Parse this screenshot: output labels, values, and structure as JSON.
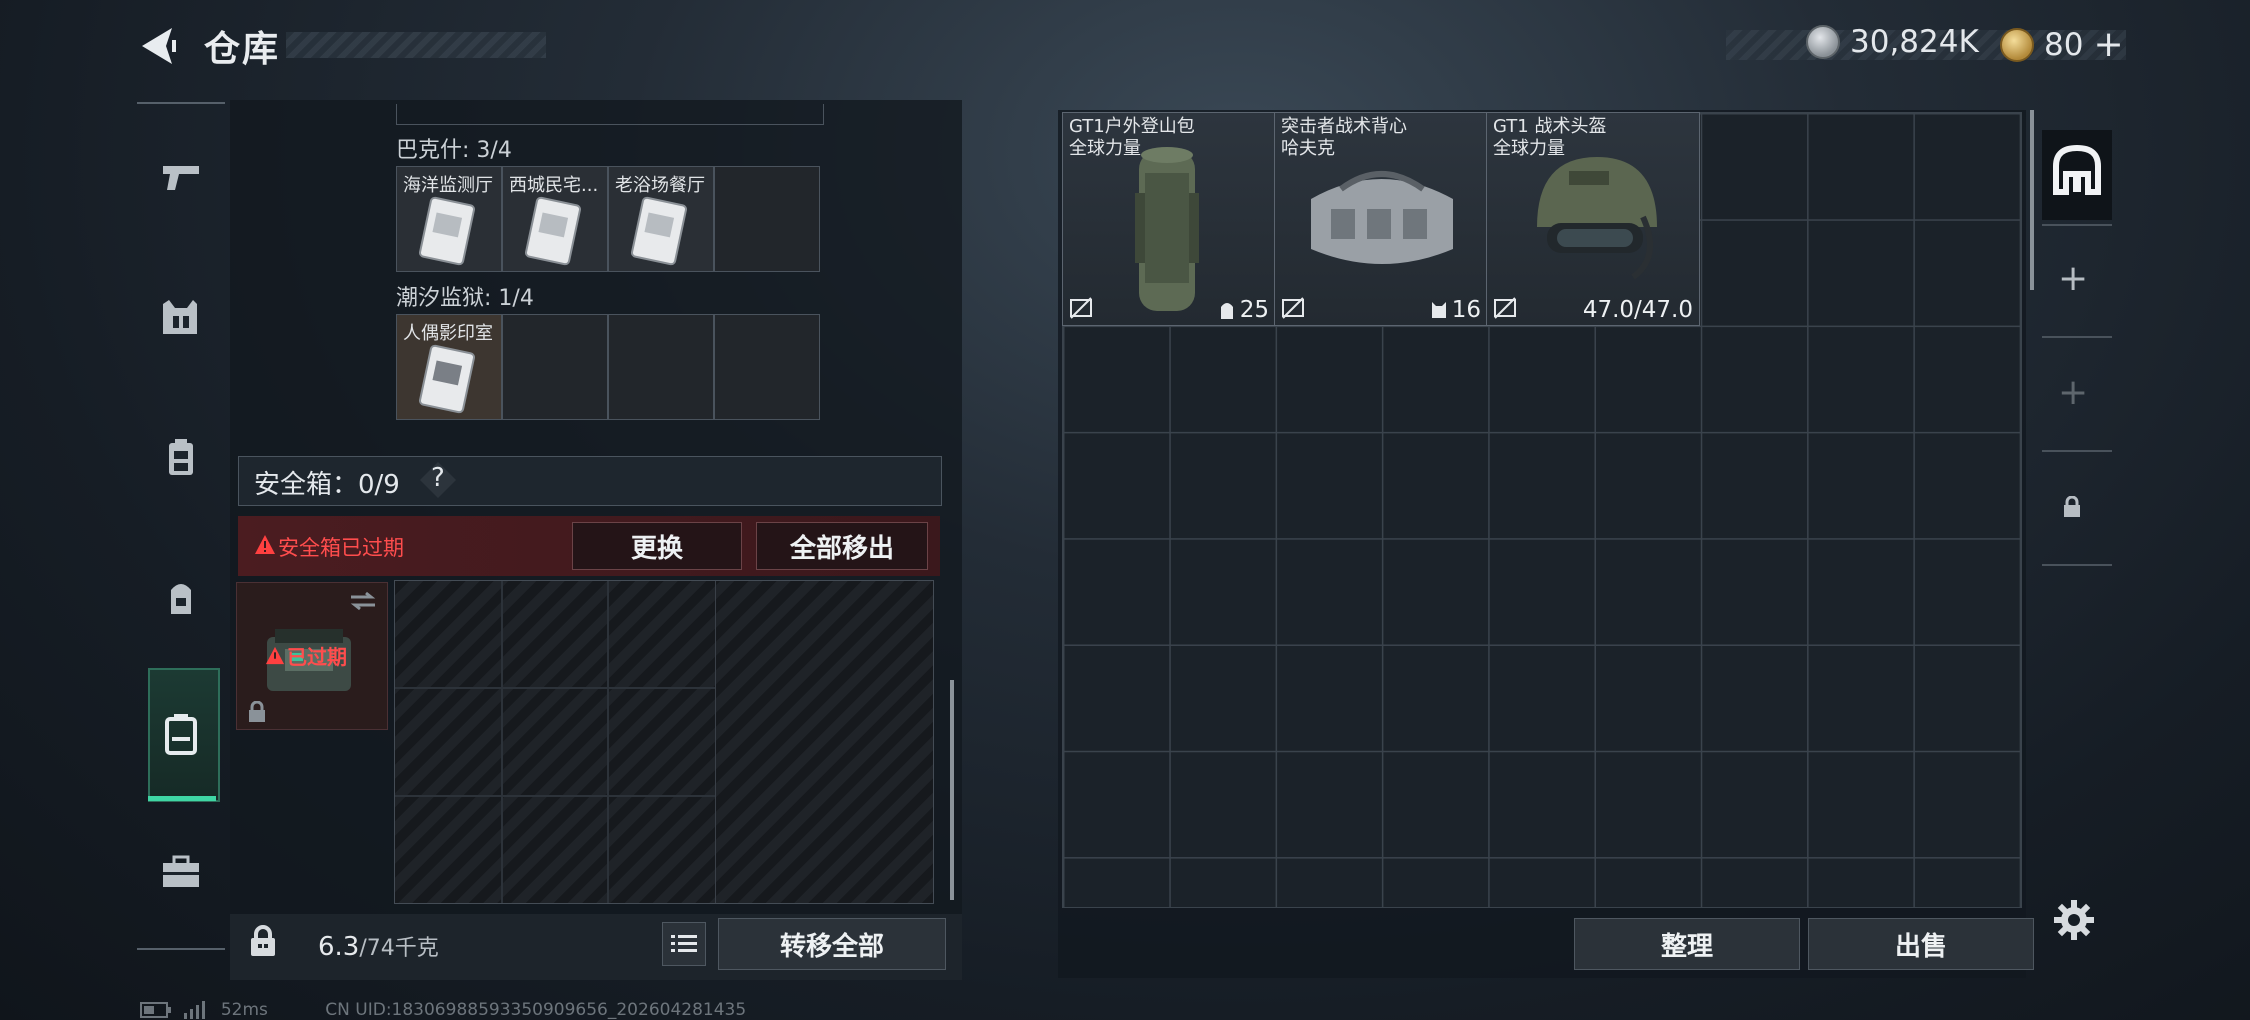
{
  "header": {
    "title": "仓库",
    "currency_silver": "30,824K",
    "currency_gold": "80",
    "gold_plus": "+"
  },
  "nav": [
    "weapon-tab",
    "armor-tab",
    "chest-rig-tab",
    "backpack-tab",
    "safe-box-tab",
    "toolbox-tab"
  ],
  "left": {
    "categories": [
      {
        "label": "巴克什: 3/4",
        "cards": [
          "海洋监测厅",
          "西城民宅...",
          "老浴场餐厅",
          ""
        ]
      },
      {
        "label": "潮汐监狱: 1/4",
        "cards": [
          "人偶影印室",
          "",
          "",
          ""
        ]
      }
    ],
    "safe_box": {
      "label": "安全箱：0/9",
      "help": "?",
      "expired_notice": "安全箱已过期",
      "replace_label": "更换",
      "remove_all_label": "全部移出",
      "box_status": "已过期"
    },
    "weight": "6.3",
    "weight_max": "/74千克",
    "transfer_all_label": "转移全部"
  },
  "right": {
    "items": [
      {
        "name_line1": "GT1户外登山包",
        "name_line2": "全球力量",
        "stat": "25",
        "stat_icon": "backpack-capacity-icon"
      },
      {
        "name_line1": "突击者战术背心",
        "name_line2": "哈夫克",
        "stat": "16",
        "stat_icon": "vest-capacity-icon"
      },
      {
        "name_line1": "GT1 战术头盔",
        "name_line2": "全球力量",
        "stat": "47.0/47.0",
        "stat_icon": ""
      }
    ],
    "sort_label": "整理",
    "sell_label": "出售",
    "side_plus": "+"
  },
  "footer": {
    "ping": "52ms",
    "uid": "CN UID:18306988593350909656_202604281435"
  }
}
